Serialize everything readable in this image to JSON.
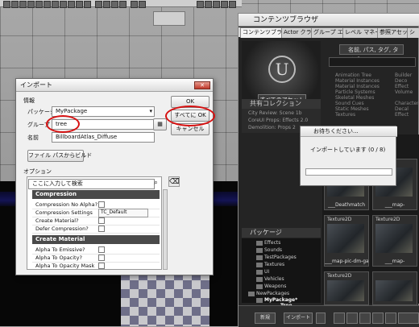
{
  "colors": {
    "accent_red": "#d61010",
    "progress_green": "#4ca84c",
    "editor_dark": "#242424"
  },
  "import_dialog": {
    "title": "インポート",
    "close_icon": "close-icon",
    "info_label": "情報",
    "package_label": "パッケージ",
    "package_value": "MyPackage",
    "group_label": "グループ",
    "group_value": "tree",
    "name_label": "名前",
    "name_value": "BillboardAtlas_Diffuse",
    "build_from_path_label": "ファイル パスからビルド",
    "ok_label": "OK",
    "ok_all_label": "すべてに OK",
    "cancel_label": "キャンセル",
    "options_label": "オプション",
    "search_placeholder": "ここに入力して検索",
    "sections": [
      {
        "title": "Compression",
        "rows": [
          {
            "label": "Compression No Alpha?"
          },
          {
            "label": "Compression Settings",
            "value": "TC_Default"
          },
          {
            "label": "Create Material?"
          },
          {
            "label": "Defer Compression?"
          }
        ]
      },
      {
        "title": "Create Material",
        "rows": [
          {
            "label": "Alpha To Emissive?"
          },
          {
            "label": "Alpha To Opacity?"
          },
          {
            "label": "Alpha To Opacity Mask"
          }
        ]
      }
    ]
  },
  "progress_dialog": {
    "title": "お待ちください...",
    "status": "インポートしています (0 / 8)",
    "progress_fraction": 0.0
  },
  "content_browser": {
    "title": "コンテンツブラウザ",
    "tabs": [
      "コンテンツブラウザ",
      "Actor クラス",
      "グループ エディタ",
      "レベル マネージャー",
      "参照アセット",
      "シ"
    ],
    "filter_label": "名前, パス, タグ, タイプ",
    "all_assets_label": "すべてのアセット",
    "shared_collections_label": "共有コレクション",
    "collections": [
      "City Review: Scene 1b",
      "CoreUI Props: Effects 2.0",
      "Demolition: Props 2"
    ],
    "filter_types": [
      "Animation Tree",
      "Material Instances",
      "Material Instances",
      "Particle Systems",
      "Skeletal Meshes",
      "Sound Cues",
      "Static Meshes",
      "Textures"
    ],
    "filter_tags": [
      "Builder",
      "Deco",
      "Effect",
      "Volume",
      "Character",
      "Decal",
      "Effect",
      "Example"
    ],
    "packages_label": "パッケージ",
    "package_tree": [
      "Effects",
      "Sounds",
      "TestPackages",
      "Textures",
      "UI",
      "Vehicles",
      "Weapons",
      "NewPackages",
      "MyPackage*",
      "Tree"
    ],
    "thumbnails": [
      {
        "tag": "",
        "name": "___Deathmatch"
      },
      {
        "tag": "",
        "name": "___map-"
      },
      {
        "tag": "Texture2D",
        "name": "___map-pic-dm-gateway"
      },
      {
        "tag": "Texture2D",
        "name": "___map-"
      },
      {
        "tag": "Texture2D",
        "name": ""
      },
      {
        "tag": "",
        "name": ""
      }
    ],
    "bottom_buttons": [
      "新規",
      "インポート"
    ]
  }
}
